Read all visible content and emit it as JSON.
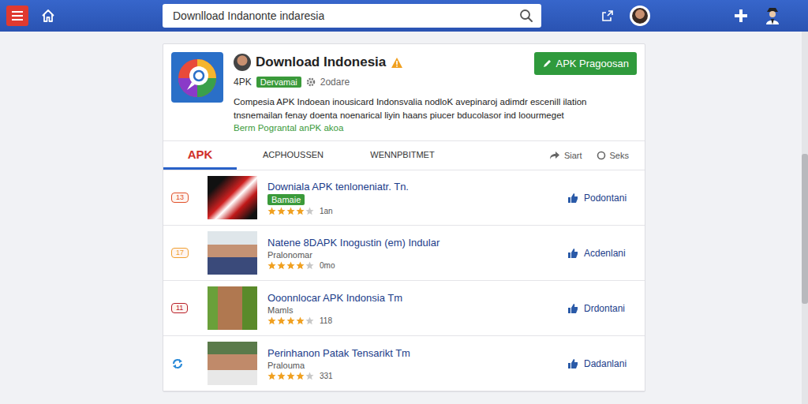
{
  "search": {
    "value": "Downlload Indanonte indaresia"
  },
  "app": {
    "title": "Download Indonesia",
    "type": "4PK",
    "badge": "Dervamai",
    "meta": "2odare",
    "button": "APK Pragoosan",
    "description": [
      "Compesia APK Indoean inousicard Indonsvalia nodloK avepinaroj adimdr escenill ilation",
      "tnsnemailan fenay doenta noenarical liyin haans piucer bducolasor ind loourmeget"
    ],
    "link": "Berm Pograntal anPK akoa"
  },
  "tabs": [
    {
      "label": "APK",
      "selected": true
    },
    {
      "label": "ACPHOUSSEN",
      "selected": false
    },
    {
      "label": "WENNPBITMET",
      "selected": false
    }
  ],
  "actions": [
    {
      "label": "Siart"
    },
    {
      "label": "Seks"
    }
  ],
  "rows": [
    {
      "kind": "rank",
      "rank": "13",
      "color": "#e0502a",
      "title": "Downiala APK tenloneniatr. Tn.",
      "tag": "Bamaie",
      "stars": 4,
      "count": "1an",
      "action": "Podontani"
    },
    {
      "kind": "rank",
      "rank": "17",
      "color": "#f0a030",
      "title": "Natene 8DAPK Inogustin (em)  Indular",
      "subtitle": "Pralonomar",
      "stars": 4,
      "count": "0mo",
      "action": "Acdenlani"
    },
    {
      "kind": "rank",
      "rank": "11",
      "color": "#b8202a",
      "title": "Ooonnlocar APK Indonsia Tm",
      "subtitle": "Mamls",
      "stars": 4,
      "count": "118",
      "action": "Drdontani"
    },
    {
      "kind": "icon",
      "title": "Perinhanon Patak Tensarikt Tm",
      "subtitle": "Pralouma",
      "stars": 4,
      "count": "331",
      "action": "Dadanlani"
    }
  ]
}
